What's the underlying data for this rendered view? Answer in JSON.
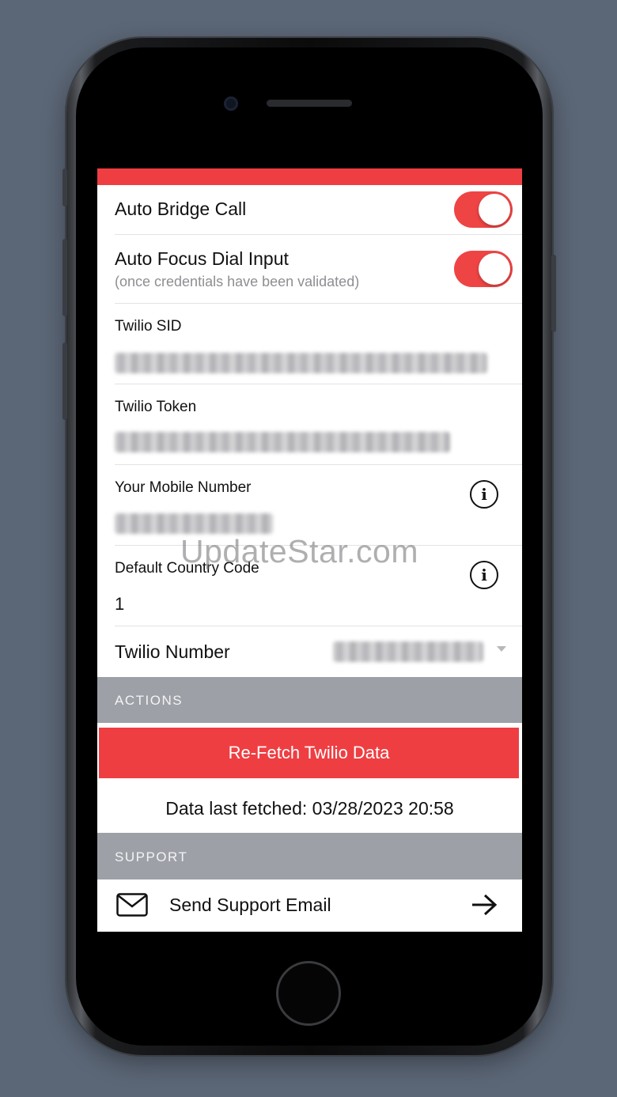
{
  "settings": {
    "auto_bridge_call": {
      "label": "Auto Bridge Call",
      "enabled": true
    },
    "auto_focus_dial": {
      "label": "Auto Focus Dial Input",
      "sublabel": "(once credentials have been validated)",
      "enabled": true
    },
    "twilio_sid": {
      "label": "Twilio SID"
    },
    "twilio_token": {
      "label": "Twilio Token"
    },
    "mobile_number": {
      "label": "Your Mobile Number"
    },
    "country_code": {
      "label": "Default Country Code",
      "value": "1"
    },
    "twilio_number": {
      "label": "Twilio Number"
    }
  },
  "actions": {
    "header": "ACTIONS",
    "refetch_label": "Re-Fetch Twilio Data",
    "last_fetched": "Data last fetched: 03/28/2023 20:58"
  },
  "support": {
    "header": "SUPPORT",
    "email_label": "Send Support Email"
  },
  "watermark": "UpdateStar.com",
  "colors": {
    "accent": "#ef3e42",
    "section_header": "#9da0a6",
    "background": "#5b6676"
  },
  "icons": {
    "info": "info-icon",
    "mail": "mail-icon",
    "arrow": "arrow-right-icon",
    "caret": "chevron-down-icon"
  }
}
